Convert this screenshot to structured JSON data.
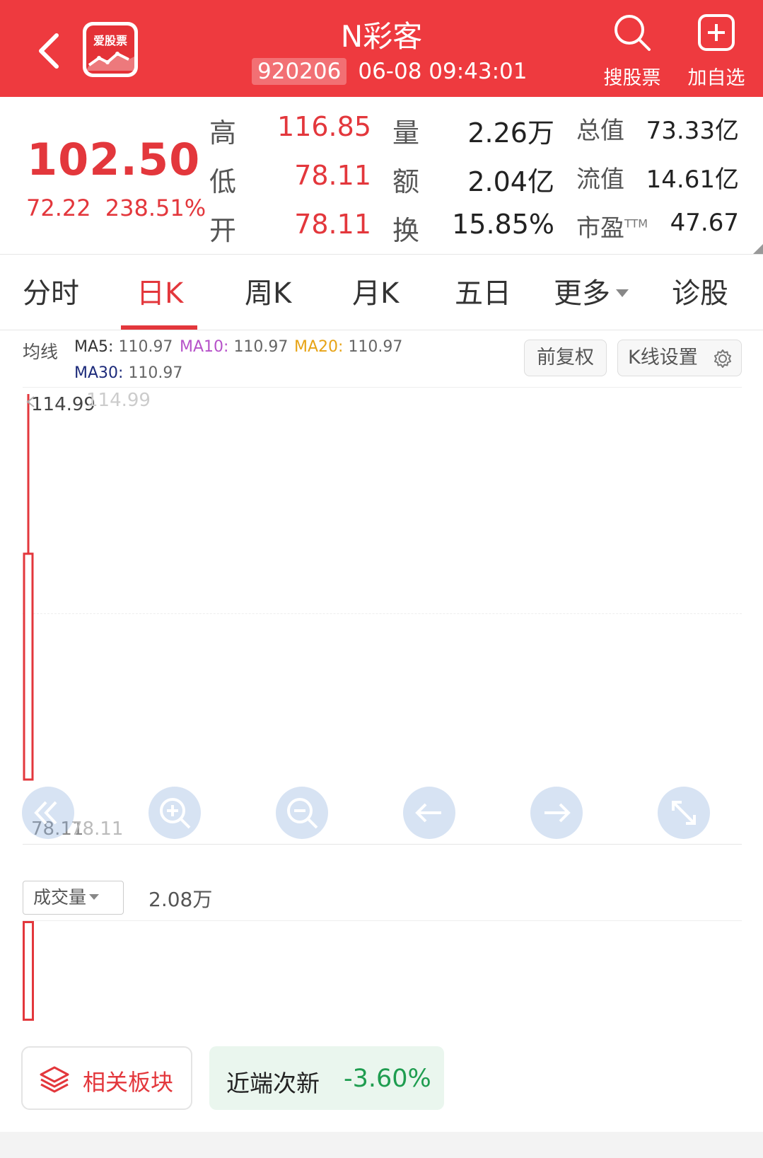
{
  "header": {
    "title": "N彩客",
    "code": "920206",
    "datetime": "06-08 09:43:01",
    "logo_text": "爱股票",
    "search_label": "搜股票",
    "add_label": "加自选",
    "bg_color": "#ee3a3f"
  },
  "quote": {
    "price": "102.50",
    "change": "72.22",
    "change_pct": "238.51%",
    "high_label": "高",
    "high": "116.85",
    "low_label": "低",
    "low": "78.11",
    "open_label": "开",
    "open": "78.11",
    "vol_label": "量",
    "vol": "2.26万",
    "amount_label": "额",
    "amount": "2.04亿",
    "turnover_label": "换",
    "turnover": "15.85%",
    "mktcap_label": "总值",
    "mktcap": "73.33亿",
    "float_label": "流值",
    "float": "14.61亿",
    "pe_label": "市盈",
    "pe_sup": "TTM",
    "pe": "47.67"
  },
  "tabs": [
    {
      "label": "分时"
    },
    {
      "label": "日K",
      "active": true
    },
    {
      "label": "周K"
    },
    {
      "label": "月K"
    },
    {
      "label": "五日"
    },
    {
      "label": "更多"
    },
    {
      "label": "诊股"
    }
  ],
  "ma": {
    "title": "均线",
    "ma5_label": "MA5:",
    "ma5": "110.97",
    "ma10_label": "MA10:",
    "ma10": "110.97",
    "ma20_label": "MA20:",
    "ma20": "110.97",
    "ma30_label": "MA30:",
    "ma30": "110.97",
    "adjust_label": "前复权",
    "settings_label": "K线设置"
  },
  "chart": {
    "max_label": "114.99",
    "max_label_ghost": "114.99",
    "min_label": "78.11",
    "min_label_ghost": "78.11"
  },
  "chart_data": {
    "type": "candlestick",
    "candles": [
      {
        "open": 78.11,
        "close": 102.5,
        "high": 116.85,
        "low": 78.11
      }
    ],
    "y_range": [
      78.11,
      114.99
    ],
    "grid": true,
    "colors": {
      "up": "#e3373c"
    }
  },
  "volume": {
    "select_label": "成交量",
    "value": "2.08万",
    "bars": [
      20800
    ]
  },
  "bottom": {
    "related_label": "相关板块",
    "sector_name": "近端次新",
    "sector_pct": "-3.60%"
  },
  "colors": {
    "up": "#e3373c",
    "down": "#1f9d50",
    "ma10": "#b652c9",
    "ma20": "#e7a316",
    "ma30": "#1c2a7a"
  }
}
